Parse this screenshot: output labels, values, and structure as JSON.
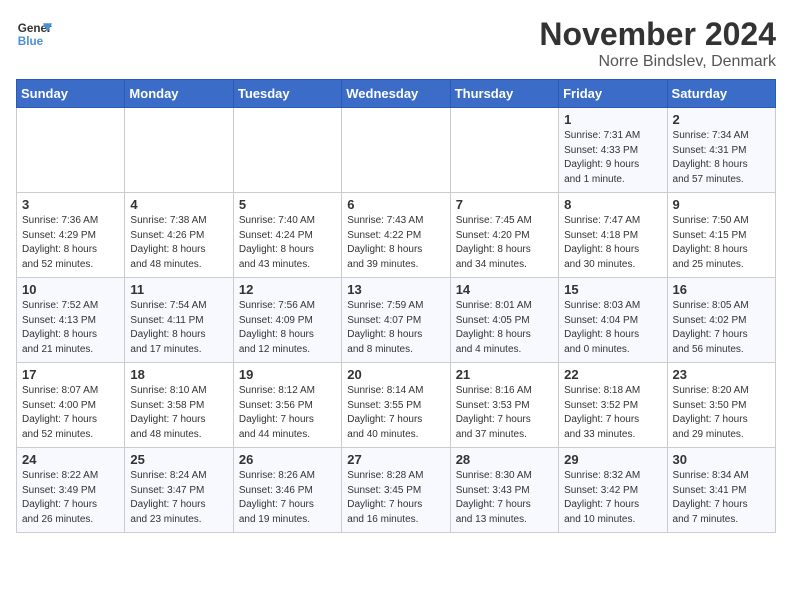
{
  "logo": {
    "line1": "General",
    "line2": "Blue"
  },
  "title": "November 2024",
  "location": "Norre Bindslev, Denmark",
  "weekdays": [
    "Sunday",
    "Monday",
    "Tuesday",
    "Wednesday",
    "Thursday",
    "Friday",
    "Saturday"
  ],
  "weeks": [
    [
      {
        "day": "",
        "info": ""
      },
      {
        "day": "",
        "info": ""
      },
      {
        "day": "",
        "info": ""
      },
      {
        "day": "",
        "info": ""
      },
      {
        "day": "",
        "info": ""
      },
      {
        "day": "1",
        "info": "Sunrise: 7:31 AM\nSunset: 4:33 PM\nDaylight: 9 hours\nand 1 minute."
      },
      {
        "day": "2",
        "info": "Sunrise: 7:34 AM\nSunset: 4:31 PM\nDaylight: 8 hours\nand 57 minutes."
      }
    ],
    [
      {
        "day": "3",
        "info": "Sunrise: 7:36 AM\nSunset: 4:29 PM\nDaylight: 8 hours\nand 52 minutes."
      },
      {
        "day": "4",
        "info": "Sunrise: 7:38 AM\nSunset: 4:26 PM\nDaylight: 8 hours\nand 48 minutes."
      },
      {
        "day": "5",
        "info": "Sunrise: 7:40 AM\nSunset: 4:24 PM\nDaylight: 8 hours\nand 43 minutes."
      },
      {
        "day": "6",
        "info": "Sunrise: 7:43 AM\nSunset: 4:22 PM\nDaylight: 8 hours\nand 39 minutes."
      },
      {
        "day": "7",
        "info": "Sunrise: 7:45 AM\nSunset: 4:20 PM\nDaylight: 8 hours\nand 34 minutes."
      },
      {
        "day": "8",
        "info": "Sunrise: 7:47 AM\nSunset: 4:18 PM\nDaylight: 8 hours\nand 30 minutes."
      },
      {
        "day": "9",
        "info": "Sunrise: 7:50 AM\nSunset: 4:15 PM\nDaylight: 8 hours\nand 25 minutes."
      }
    ],
    [
      {
        "day": "10",
        "info": "Sunrise: 7:52 AM\nSunset: 4:13 PM\nDaylight: 8 hours\nand 21 minutes."
      },
      {
        "day": "11",
        "info": "Sunrise: 7:54 AM\nSunset: 4:11 PM\nDaylight: 8 hours\nand 17 minutes."
      },
      {
        "day": "12",
        "info": "Sunrise: 7:56 AM\nSunset: 4:09 PM\nDaylight: 8 hours\nand 12 minutes."
      },
      {
        "day": "13",
        "info": "Sunrise: 7:59 AM\nSunset: 4:07 PM\nDaylight: 8 hours\nand 8 minutes."
      },
      {
        "day": "14",
        "info": "Sunrise: 8:01 AM\nSunset: 4:05 PM\nDaylight: 8 hours\nand 4 minutes."
      },
      {
        "day": "15",
        "info": "Sunrise: 8:03 AM\nSunset: 4:04 PM\nDaylight: 8 hours\nand 0 minutes."
      },
      {
        "day": "16",
        "info": "Sunrise: 8:05 AM\nSunset: 4:02 PM\nDaylight: 7 hours\nand 56 minutes."
      }
    ],
    [
      {
        "day": "17",
        "info": "Sunrise: 8:07 AM\nSunset: 4:00 PM\nDaylight: 7 hours\nand 52 minutes."
      },
      {
        "day": "18",
        "info": "Sunrise: 8:10 AM\nSunset: 3:58 PM\nDaylight: 7 hours\nand 48 minutes."
      },
      {
        "day": "19",
        "info": "Sunrise: 8:12 AM\nSunset: 3:56 PM\nDaylight: 7 hours\nand 44 minutes."
      },
      {
        "day": "20",
        "info": "Sunrise: 8:14 AM\nSunset: 3:55 PM\nDaylight: 7 hours\nand 40 minutes."
      },
      {
        "day": "21",
        "info": "Sunrise: 8:16 AM\nSunset: 3:53 PM\nDaylight: 7 hours\nand 37 minutes."
      },
      {
        "day": "22",
        "info": "Sunrise: 8:18 AM\nSunset: 3:52 PM\nDaylight: 7 hours\nand 33 minutes."
      },
      {
        "day": "23",
        "info": "Sunrise: 8:20 AM\nSunset: 3:50 PM\nDaylight: 7 hours\nand 29 minutes."
      }
    ],
    [
      {
        "day": "24",
        "info": "Sunrise: 8:22 AM\nSunset: 3:49 PM\nDaylight: 7 hours\nand 26 minutes."
      },
      {
        "day": "25",
        "info": "Sunrise: 8:24 AM\nSunset: 3:47 PM\nDaylight: 7 hours\nand 23 minutes."
      },
      {
        "day": "26",
        "info": "Sunrise: 8:26 AM\nSunset: 3:46 PM\nDaylight: 7 hours\nand 19 minutes."
      },
      {
        "day": "27",
        "info": "Sunrise: 8:28 AM\nSunset: 3:45 PM\nDaylight: 7 hours\nand 16 minutes."
      },
      {
        "day": "28",
        "info": "Sunrise: 8:30 AM\nSunset: 3:43 PM\nDaylight: 7 hours\nand 13 minutes."
      },
      {
        "day": "29",
        "info": "Sunrise: 8:32 AM\nSunset: 3:42 PM\nDaylight: 7 hours\nand 10 minutes."
      },
      {
        "day": "30",
        "info": "Sunrise: 8:34 AM\nSunset: 3:41 PM\nDaylight: 7 hours\nand 7 minutes."
      }
    ]
  ]
}
